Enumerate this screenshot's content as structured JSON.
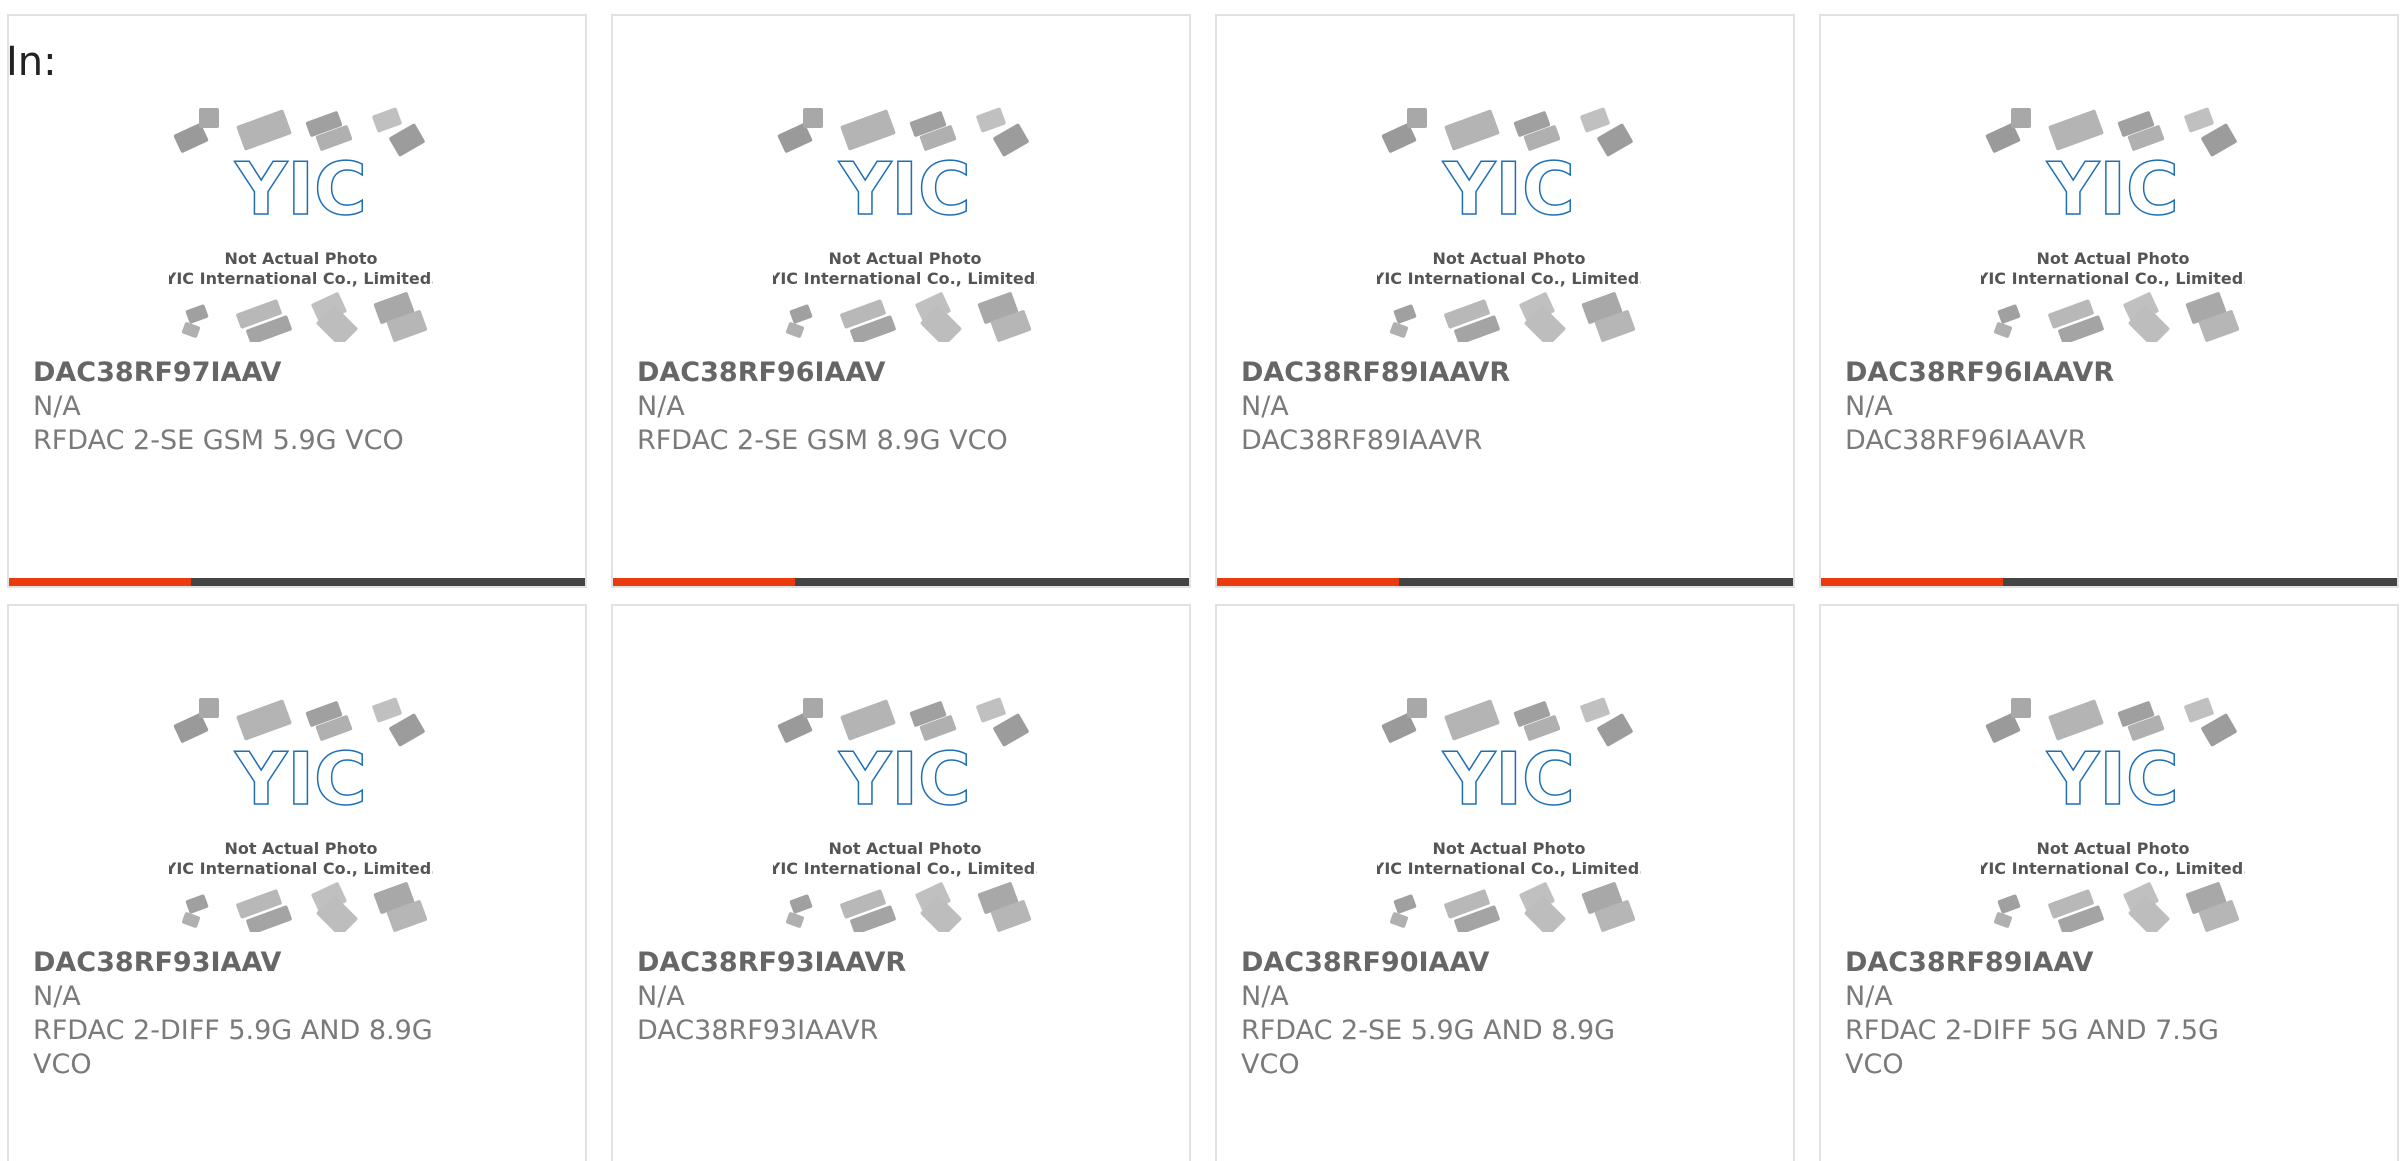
{
  "header": {
    "label": "In:"
  },
  "colors": {
    "accent": "#ea3b0f",
    "bar": "#444444",
    "logo": "#1f6fb5"
  },
  "placeholder": {
    "logo_text": "YIC",
    "line1": "Not Actual Photo",
    "line2": "YIC International Co., Limited."
  },
  "products": [
    {
      "part": "DAC38RF97IAAV",
      "mfr": "N/A",
      "desc": "RFDAC 2-SE GSM 5.9G VCO"
    },
    {
      "part": "DAC38RF96IAAV",
      "mfr": "N/A",
      "desc": "RFDAC 2-SE GSM 8.9G VCO"
    },
    {
      "part": "DAC38RF89IAAVR",
      "mfr": "N/A",
      "desc": "DAC38RF89IAAVR"
    },
    {
      "part": "DAC38RF96IAAVR",
      "mfr": "N/A",
      "desc": "DAC38RF96IAAVR"
    },
    {
      "part": "DAC38RF93IAAV",
      "mfr": "N/A",
      "desc": "RFDAC 2-DIFF 5.9G AND 8.9G VCO"
    },
    {
      "part": "DAC38RF93IAAVR",
      "mfr": "N/A",
      "desc": "DAC38RF93IAAVR"
    },
    {
      "part": "DAC38RF90IAAV",
      "mfr": "N/A",
      "desc": "RFDAC 2-SE 5.9G AND 8.9G VCO"
    },
    {
      "part": "DAC38RF89IAAV",
      "mfr": "N/A",
      "desc": "RFDAC 2-DIFF 5G AND 7.5G VCO"
    }
  ]
}
